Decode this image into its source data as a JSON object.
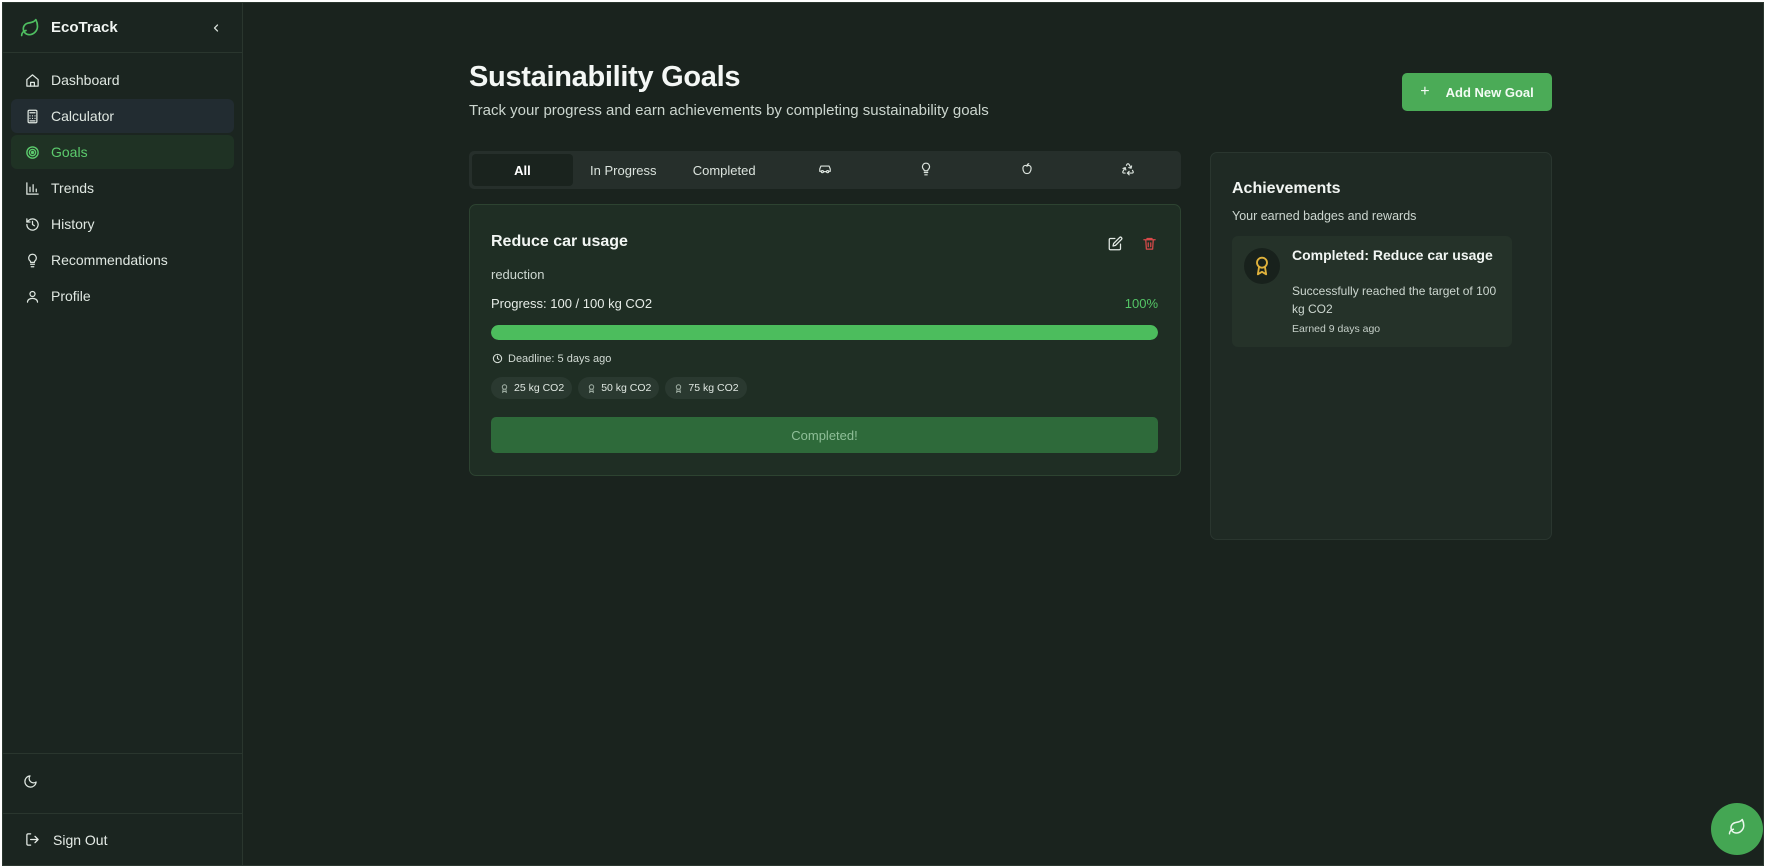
{
  "app": {
    "name": "EcoTrack",
    "collapse_icon": "chevron-left-icon"
  },
  "sidebar": {
    "items": [
      {
        "label": "Dashboard",
        "icon": "home-icon",
        "state": "default"
      },
      {
        "label": "Calculator",
        "icon": "calculator-icon",
        "state": "hover"
      },
      {
        "label": "Goals",
        "icon": "target-icon",
        "state": "active"
      },
      {
        "label": "Trends",
        "icon": "bar-chart-icon",
        "state": "default"
      },
      {
        "label": "History",
        "icon": "history-icon",
        "state": "default"
      },
      {
        "label": "Recommendations",
        "icon": "lightbulb-icon",
        "state": "default"
      },
      {
        "label": "Profile",
        "icon": "user-icon",
        "state": "default"
      }
    ],
    "theme_toggle_icon": "moon-icon",
    "sign_out_label": "Sign Out"
  },
  "page": {
    "title": "Sustainability Goals",
    "subtitle": "Track your progress and earn achievements by completing sustainability goals",
    "add_button_label": "Add New Goal"
  },
  "tabs": [
    {
      "label": "All",
      "active": true
    },
    {
      "label": "In Progress",
      "active": false
    },
    {
      "label": "Completed",
      "active": false
    },
    {
      "icon": "car-icon"
    },
    {
      "icon": "lightbulb-icon"
    },
    {
      "icon": "apple-icon"
    },
    {
      "icon": "recycle-icon"
    }
  ],
  "goal": {
    "title": "Reduce car usage",
    "category": "reduction",
    "progress_label": "Progress: 100 / 100 kg CO2",
    "progress_percent": "100%",
    "progress_fraction": 1.0,
    "deadline": "Deadline: 5 days ago",
    "milestones": [
      "25 kg CO2",
      "50 kg CO2",
      "75 kg CO2"
    ],
    "status_button": "Completed!"
  },
  "achievements": {
    "title": "Achievements",
    "subtitle": "Your earned badges and rewards",
    "items": [
      {
        "title": "Completed: Reduce car usage",
        "description": "Successfully reached the target of 100 kg CO2",
        "earned": "Earned 9 days ago",
        "icon": "award-icon"
      }
    ]
  },
  "colors": {
    "background": "#1a231e",
    "accent": "#4bab57",
    "active_text": "#5ccb6d",
    "danger": "#d84a4a",
    "gold": "#e0b23c"
  }
}
